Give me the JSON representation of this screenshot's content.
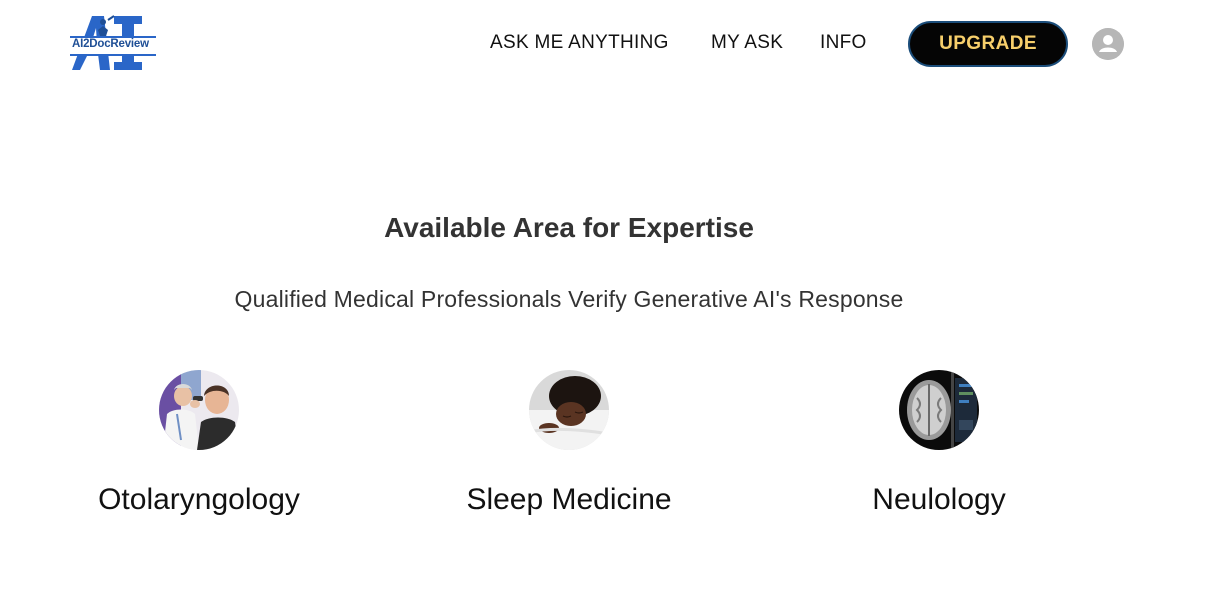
{
  "header": {
    "logo_text": "AI2DocReview",
    "nav": [
      {
        "label": "ASK ME ANYTHING"
      },
      {
        "label": "MY ASK"
      },
      {
        "label": "INFO"
      }
    ],
    "upgrade_label": "UPGRADE",
    "avatar_icon": "user-icon"
  },
  "main": {
    "title": "Available Area for Expertise",
    "subtitle": "Qualified Medical Professionals Verify Generative AI's Response",
    "areas": [
      {
        "label": "Otolaryngology",
        "image": "doctor-examining-ear"
      },
      {
        "label": "Sleep Medicine",
        "image": "sleeping-woman"
      },
      {
        "label": "Neulology",
        "image": "brain-mri-scan"
      }
    ]
  },
  "colors": {
    "upgrade_bg": "#050505",
    "upgrade_text": "#f7cf6b",
    "logo_blue": "#1f5fbf"
  }
}
